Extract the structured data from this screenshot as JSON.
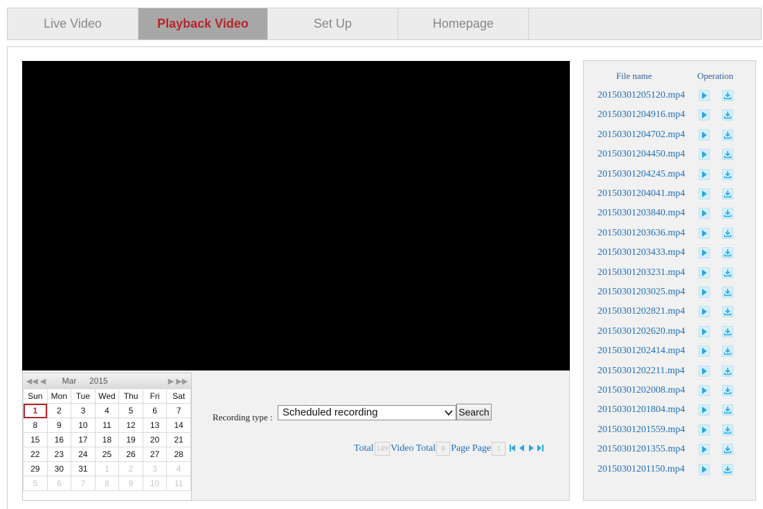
{
  "tabs": [
    "Live Video",
    "Playback Video",
    "Set Up",
    "Homepage"
  ],
  "active_tab": "Playback Video",
  "calendar": {
    "month": "Mar",
    "year": "2015",
    "weekdays": [
      "Sun",
      "Mon",
      "Tue",
      "Wed",
      "Thu",
      "Fri",
      "Sat"
    ],
    "weeks": [
      [
        "1",
        "2",
        "3",
        "4",
        "5",
        "6",
        "7"
      ],
      [
        "8",
        "9",
        "10",
        "11",
        "12",
        "13",
        "14"
      ],
      [
        "15",
        "16",
        "17",
        "18",
        "19",
        "20",
        "21"
      ],
      [
        "22",
        "23",
        "24",
        "25",
        "26",
        "27",
        "28"
      ],
      [
        "29",
        "30",
        "31",
        "1",
        "2",
        "3",
        "4"
      ],
      [
        "5",
        "6",
        "7",
        "8",
        "9",
        "10",
        "11"
      ]
    ],
    "selected_day": "1"
  },
  "recording": {
    "label": "Recording type :",
    "value": "Scheduled recording",
    "search_label": "Search"
  },
  "pager": {
    "total_label": "Total",
    "total_count": "149",
    "video_total_label": "Video Total",
    "page_count": "8",
    "page_label": "Page Page",
    "current_page": "1"
  },
  "files": {
    "header_name": "File name",
    "header_op": "Operation",
    "items": [
      "20150301205120.mp4",
      "20150301204916.mp4",
      "20150301204702.mp4",
      "20150301204450.mp4",
      "20150301204245.mp4",
      "20150301204041.mp4",
      "20150301203840.mp4",
      "20150301203636.mp4",
      "20150301203433.mp4",
      "20150301203231.mp4",
      "20150301203025.mp4",
      "20150301202821.mp4",
      "20150301202620.mp4",
      "20150301202414.mp4",
      "20150301202211.mp4",
      "20150301202008.mp4",
      "20150301201804.mp4",
      "20150301201559.mp4",
      "20150301201355.mp4",
      "20150301201150.mp4"
    ],
    "play_icon": "play-icon",
    "download_icon": "download-icon"
  },
  "colors": {
    "active_tab_text": "#b5262a",
    "link": "#1f6fb8",
    "icon": "#2aa6df"
  }
}
